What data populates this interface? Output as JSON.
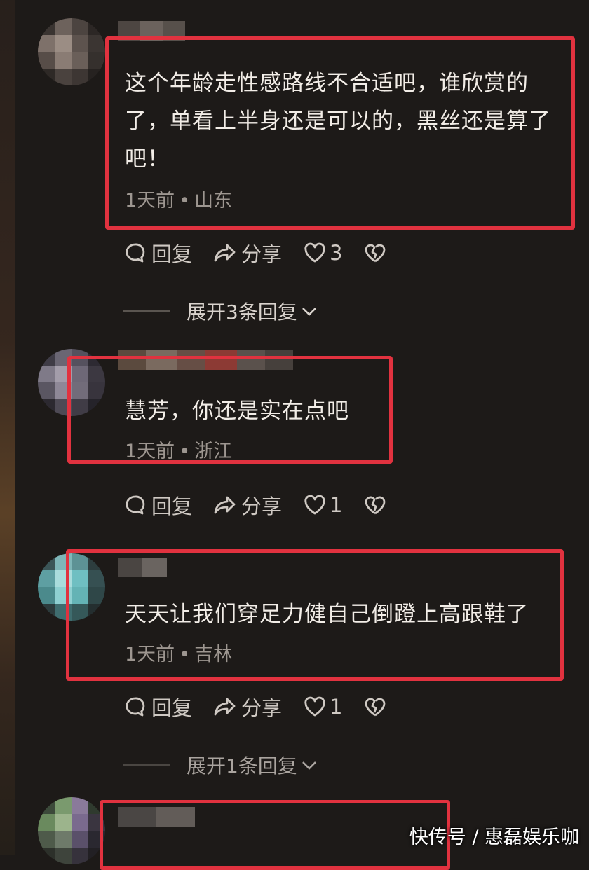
{
  "comments": [
    {
      "text": "这个年龄走性感路线不合适吧，谁欣赏的了，单看上半身还是可以的，黑丝还是算了吧！",
      "time": "1天前",
      "location": "山东",
      "reply_label": "回复",
      "share_label": "分享",
      "likes": "3",
      "expand_label": "展开3条回复"
    },
    {
      "text": "慧芳，你还是实在点吧",
      "time": "1天前",
      "location": "浙江",
      "reply_label": "回复",
      "share_label": "分享",
      "likes": "1"
    },
    {
      "text": "天天让我们穿足力健自己倒蹬上高跟鞋了",
      "time": "1天前",
      "location": "吉林",
      "reply_label": "回复",
      "share_label": "分享",
      "likes": "1",
      "expand_label": "展开1条回复"
    }
  ],
  "watermark": "快传号 / 惠磊娱乐咖",
  "colors": {
    "highlight_box": "#e1323f",
    "background": "#1d1a18"
  },
  "icons": [
    "reply-icon",
    "share-icon",
    "heart-icon",
    "dislike-icon",
    "chevron-down-icon"
  ]
}
